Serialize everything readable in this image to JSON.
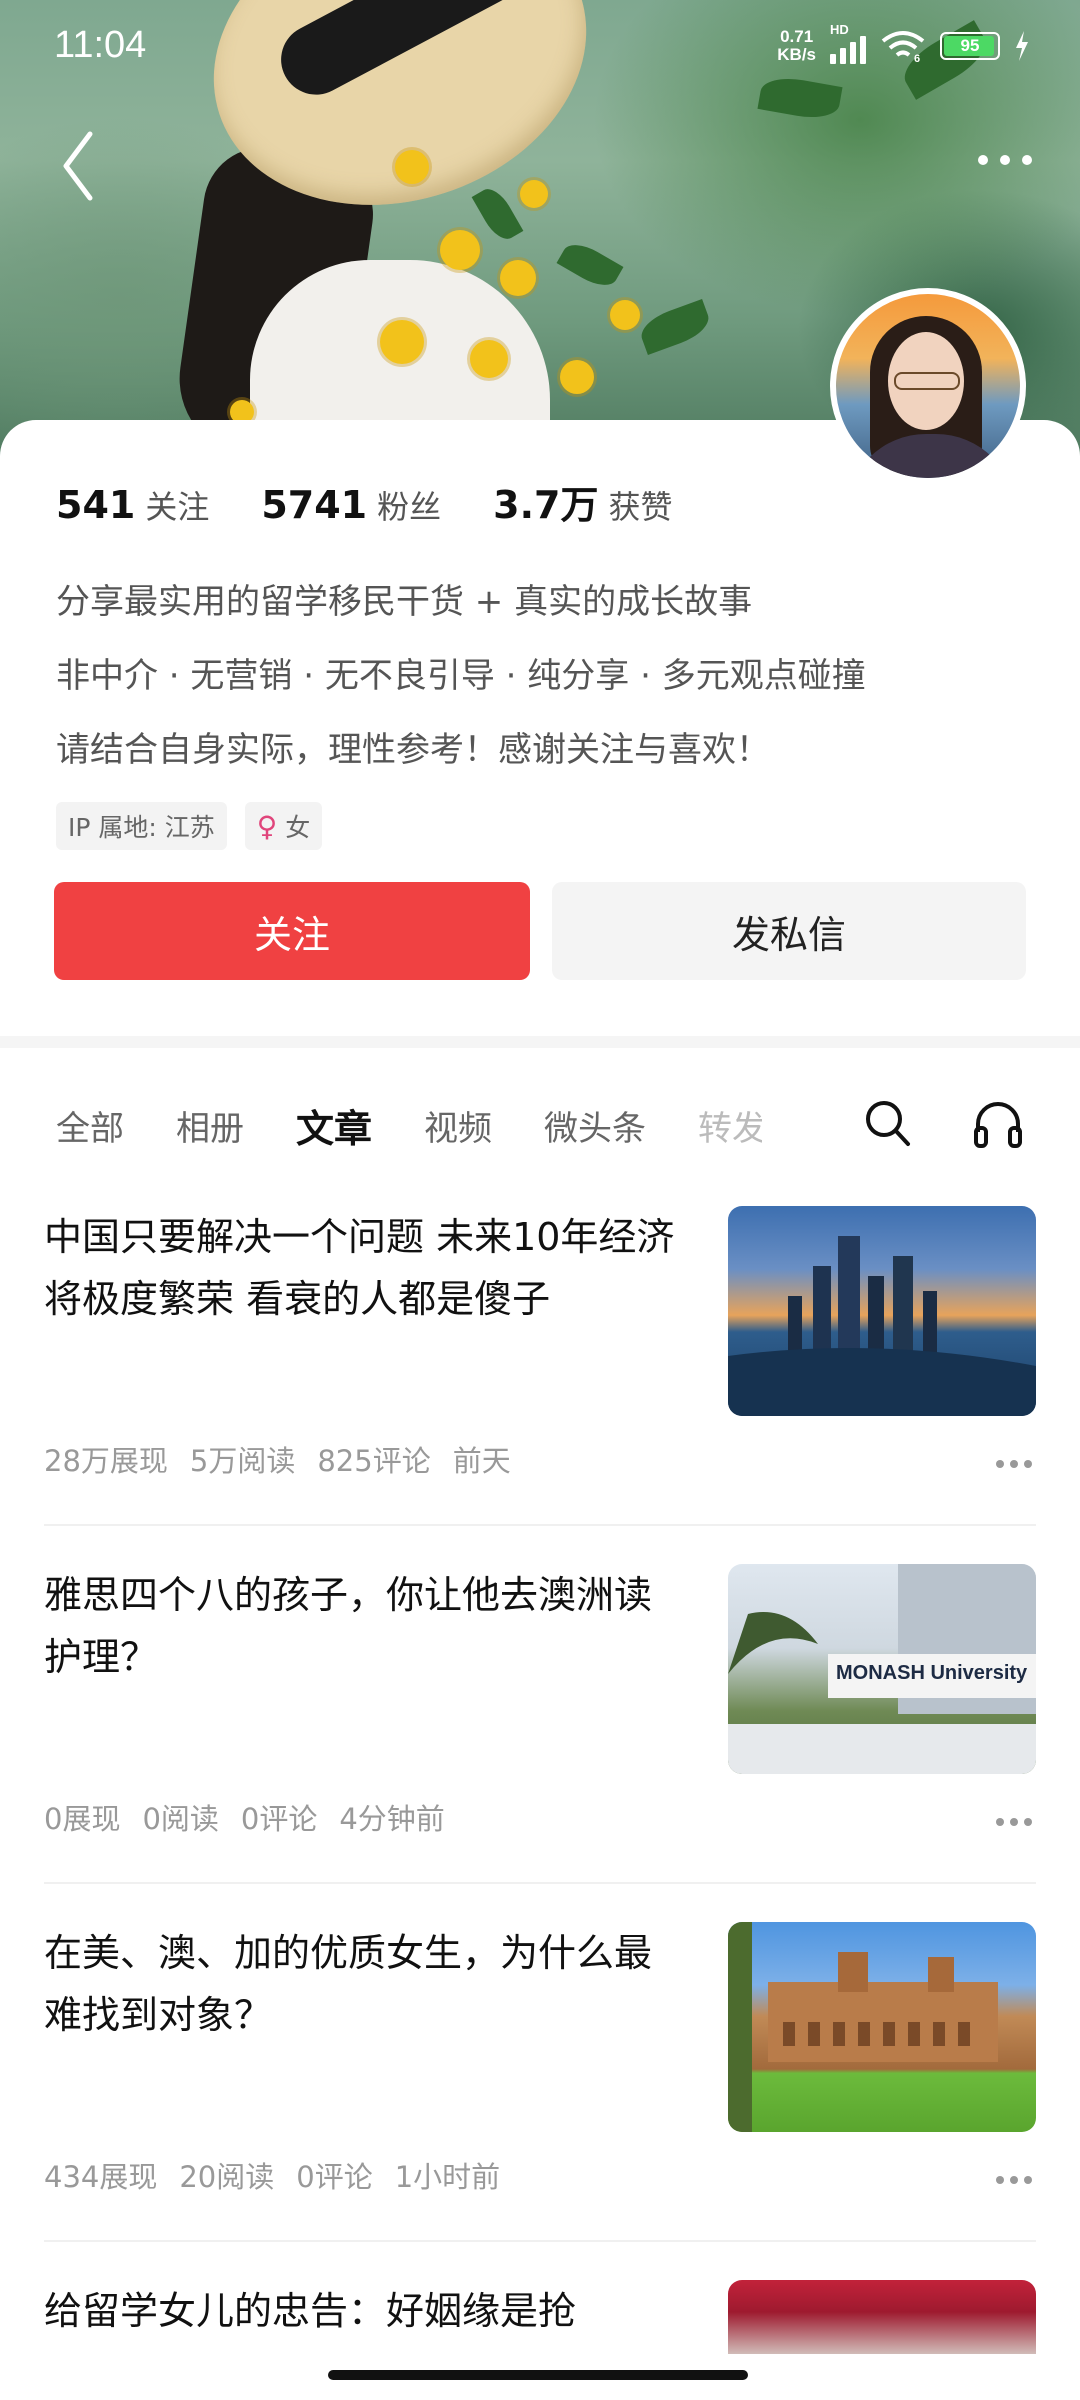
{
  "status_bar": {
    "time": "11:04",
    "net_speed_value": "0.71",
    "net_speed_unit": "KB/s",
    "hd_label": "HD",
    "wifi_label": "6",
    "battery_level": "95"
  },
  "profile": {
    "stats": [
      {
        "num": "541",
        "label": "关注"
      },
      {
        "num": "5741",
        "label": "粉丝"
      },
      {
        "num": "3.7万",
        "label": "获赞"
      }
    ],
    "bio_lines": [
      "分享最实用的留学移民干货 + 真实的成长故事",
      "非中介 · 无营销 · 无不良引导 · 纯分享 · 多元观点碰撞",
      "请结合自身实际，理性参考！感谢关注与喜欢！"
    ],
    "ip_tag": "IP 属地: 江苏",
    "gender_symbol": "♀",
    "gender_tag": "女",
    "follow_button": "关注",
    "message_button": "发私信"
  },
  "tabs": [
    "全部",
    "相册",
    "文章",
    "视频",
    "微头条",
    "转发"
  ],
  "active_tab": "文章",
  "articles": [
    {
      "title": "中国只要解决一个问题 未来10年经济将极度繁荣 看衰的人都是傻子",
      "impressions": "28万展现",
      "reads": "5万阅读",
      "comments": "825评论",
      "time": "前天"
    },
    {
      "title": "雅思四个八的孩子，你让他去澳洲读护理？",
      "impressions": "0展现",
      "reads": "0阅读",
      "comments": "0评论",
      "time": "4分钟前",
      "thumb_text": "MONASH University"
    },
    {
      "title": "在美、澳、加的优质女生，为什么最难找到对象？",
      "impressions": "434展现",
      "reads": "20阅读",
      "comments": "0评论",
      "time": "1小时前"
    },
    {
      "title": "给留学女儿的忠告：好姻缘是抢"
    }
  ],
  "colors": {
    "accent": "#f04142",
    "secondary_button_bg": "#f4f4f4",
    "meta_text": "#999999",
    "battery_fill": "#4cd964"
  },
  "icons": [
    "back-arrow-icon",
    "more-icon",
    "search-icon",
    "headphone-icon",
    "female-icon",
    "wifi-icon",
    "signal-icon",
    "battery-icon"
  ]
}
